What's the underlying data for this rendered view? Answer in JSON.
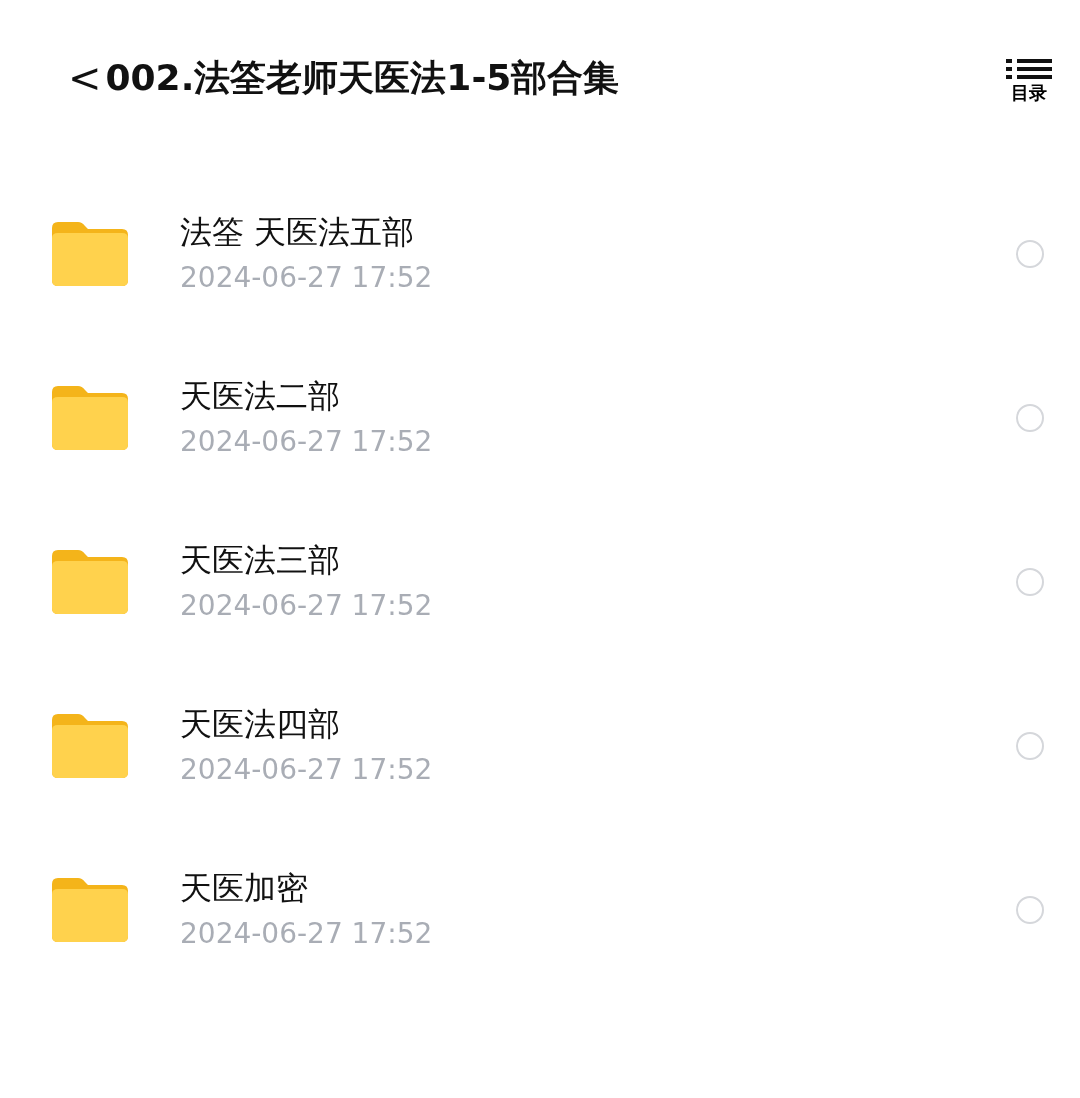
{
  "header": {
    "back": "<",
    "title": "002.法筌老师天医法1-5部合集",
    "toc_label": "目录"
  },
  "folders": [
    {
      "name": "法筌 天医法五部",
      "date": "2024-06-27 17:52",
      "selected": false
    },
    {
      "name": "天医法二部",
      "date": "2024-06-27 17:52",
      "selected": false
    },
    {
      "name": "天医法三部",
      "date": "2024-06-27 17:52",
      "selected": false
    },
    {
      "name": "天医法四部",
      "date": "2024-06-27 17:52",
      "selected": false
    },
    {
      "name": "天医加密",
      "date": "2024-06-27 17:52",
      "selected": false
    }
  ]
}
